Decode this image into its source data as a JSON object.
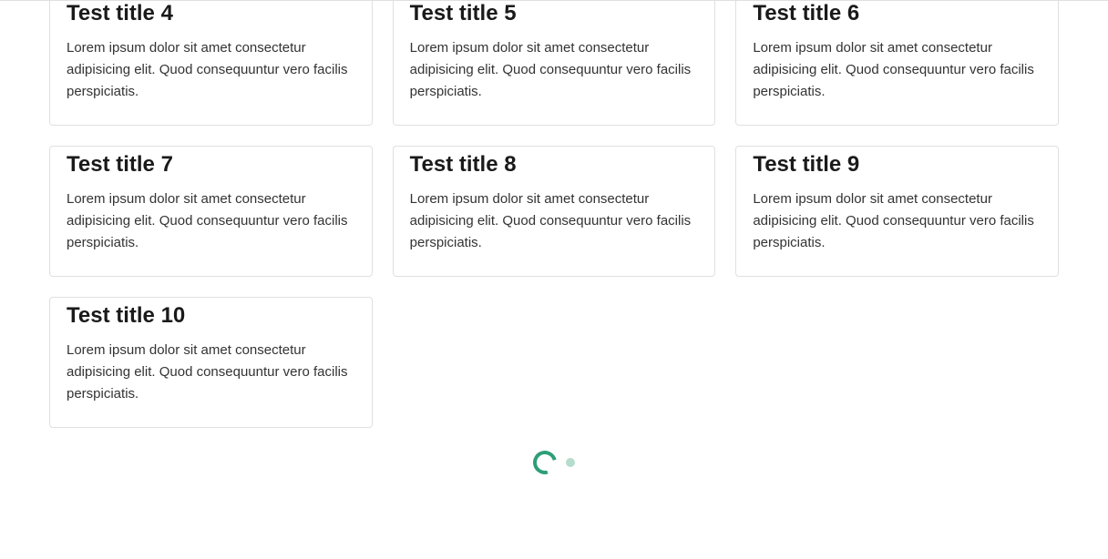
{
  "cards": [
    {
      "title": "Test title 4",
      "body": "Lorem ipsum dolor sit amet consectetur adipisicing elit. Quod consequuntur vero facilis perspiciatis."
    },
    {
      "title": "Test title 5",
      "body": "Lorem ipsum dolor sit amet consectetur adipisicing elit. Quod consequuntur vero facilis perspiciatis."
    },
    {
      "title": "Test title 6",
      "body": "Lorem ipsum dolor sit amet consectetur adipisicing elit. Quod consequuntur vero facilis perspiciatis."
    },
    {
      "title": "Test title 7",
      "body": "Lorem ipsum dolor sit amet consectetur adipisicing elit. Quod consequuntur vero facilis perspiciatis."
    },
    {
      "title": "Test title 8",
      "body": "Lorem ipsum dolor sit amet consectetur adipisicing elit. Quod consequuntur vero facilis perspiciatis."
    },
    {
      "title": "Test title 9",
      "body": "Lorem ipsum dolor sit amet consectetur adipisicing elit. Quod consequuntur vero facilis perspiciatis."
    },
    {
      "title": "Test title 10",
      "body": "Lorem ipsum dolor sit amet consectetur adipisicing elit. Quod consequuntur vero facilis perspiciatis."
    }
  ],
  "spinner": {
    "name": "loading"
  }
}
